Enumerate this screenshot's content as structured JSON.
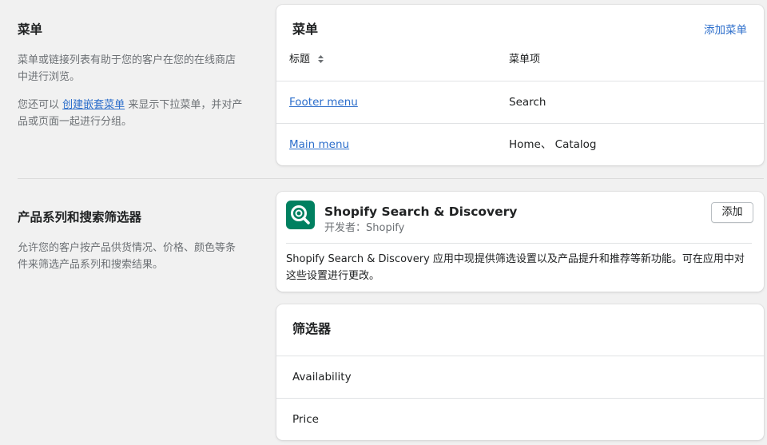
{
  "menus_section": {
    "title": "菜单",
    "desc": "菜单或链接列表有助于您的客户在您的在线商店中进行浏览。",
    "desc2_prefix": "您还可以",
    "desc2_link": "创建嵌套菜单",
    "desc2_suffix": "来显示下拉菜单，并对产品或页面一起进行分组。"
  },
  "menus_card": {
    "title": "菜单",
    "add_label": "添加菜单",
    "col_title": "标题",
    "col_items": "菜单项",
    "rows": [
      {
        "name": "Footer menu",
        "items": "Search"
      },
      {
        "name": "Main menu",
        "items": "Home、 Catalog"
      }
    ]
  },
  "filters_section": {
    "title": "产品系列和搜索筛选器",
    "desc": "允许您的客户按产品供货情况、价格、颜色等条件来筛选产品系列和搜索结果。"
  },
  "app_card": {
    "name": "Shopify Search & Discovery",
    "developer": "开发者：Shopify",
    "add_label": "添加",
    "description": "Shopify Search & Discovery 应用中现提供筛选设置以及产品提升和推荐等新功能。可在应用中对这些设置进行更改。",
    "icon": "search-discovery-icon",
    "icon_color": "#008060"
  },
  "filters_card": {
    "title": "筛选器",
    "items": [
      "Availability",
      "Price"
    ]
  },
  "colors": {
    "link": "#2c6ecb",
    "background": "#f1f1f1"
  }
}
